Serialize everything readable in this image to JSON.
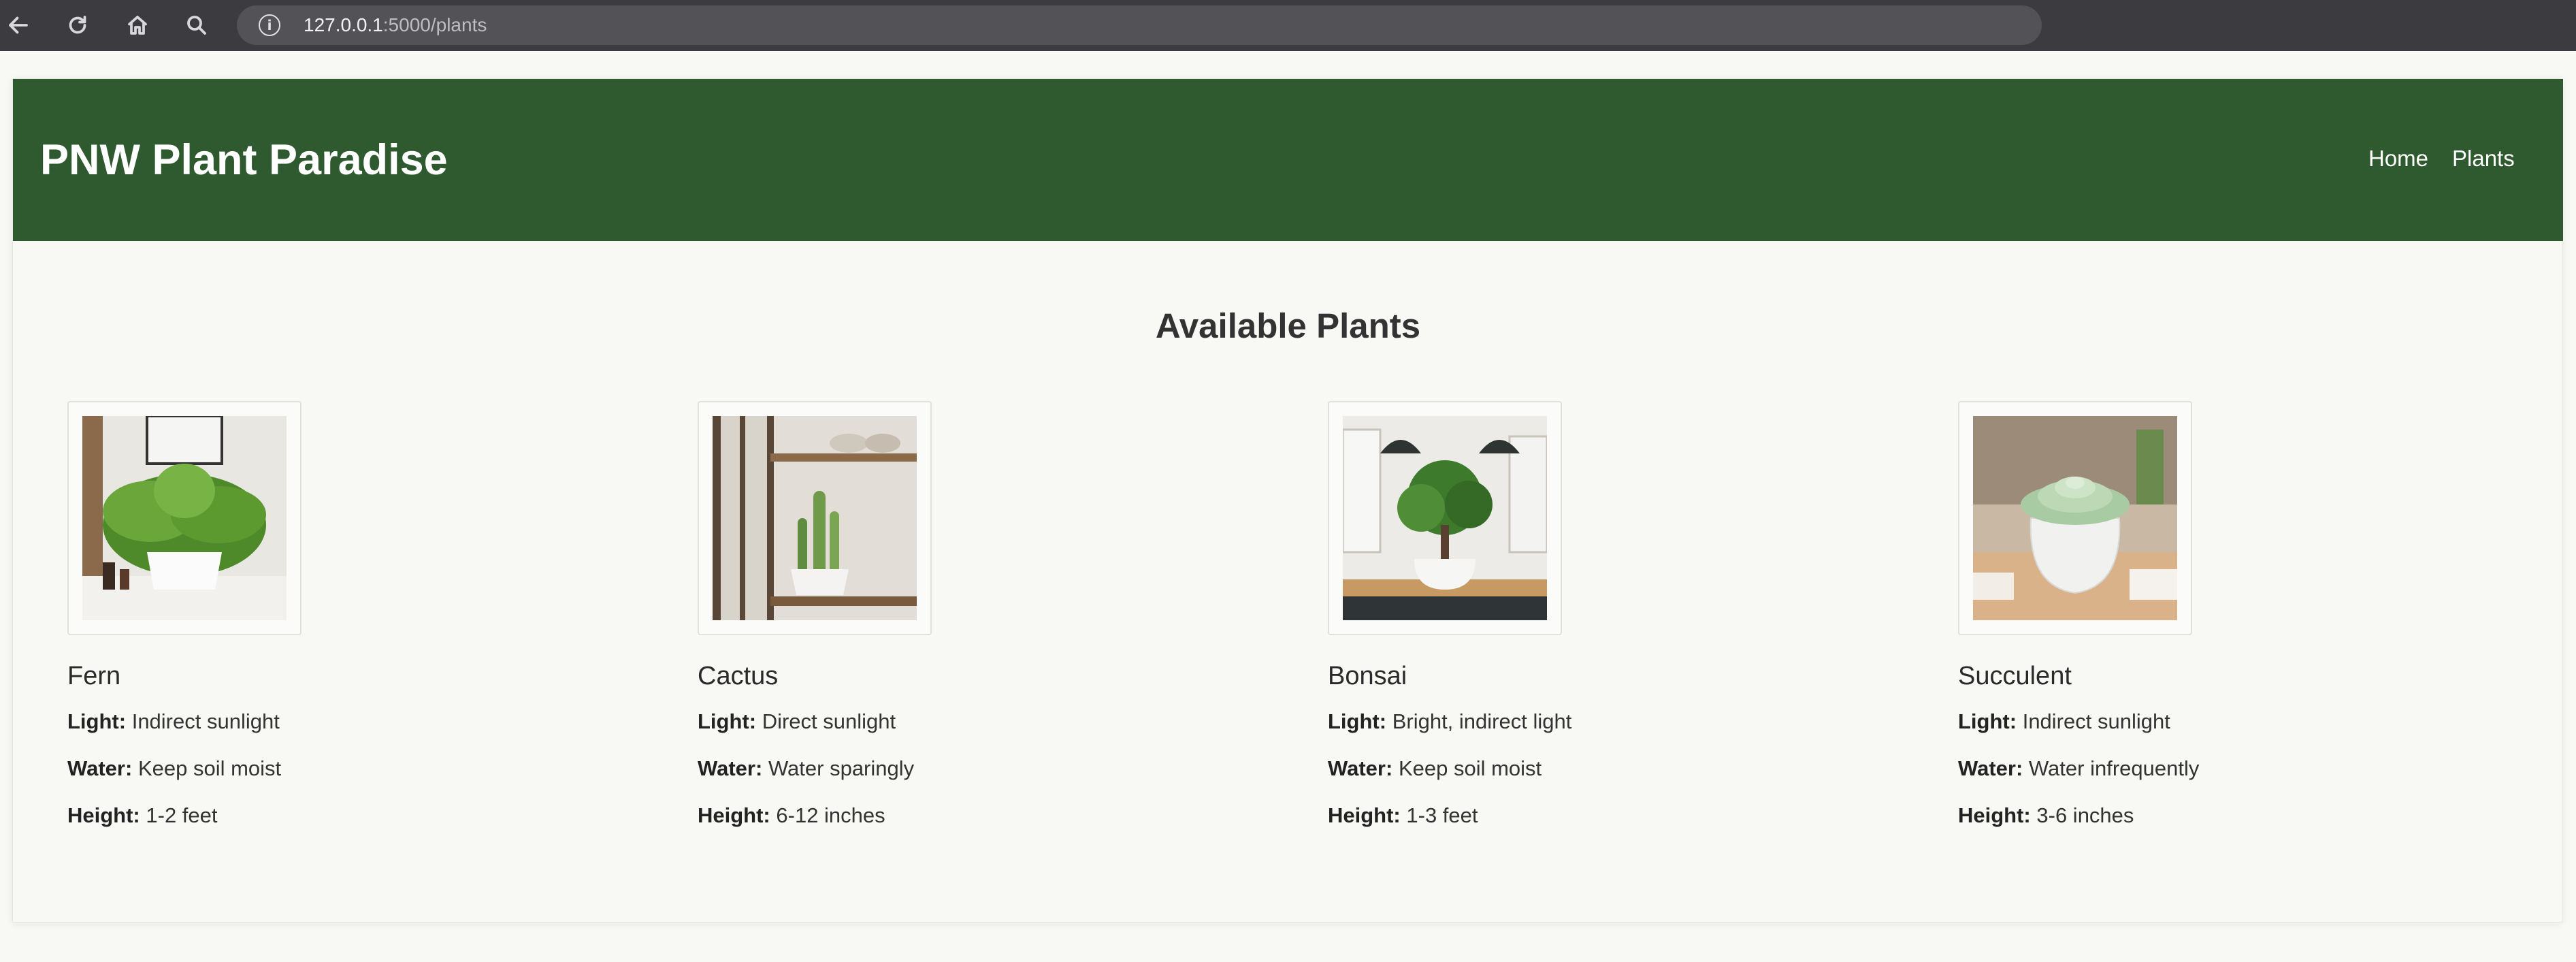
{
  "browser": {
    "url_host": "127.0.0.1",
    "url_path": ":5000/plants"
  },
  "header": {
    "brand": "PNW Plant Paradise",
    "nav": [
      "Home",
      "Plants"
    ]
  },
  "main": {
    "title": "Available Plants",
    "plants": [
      {
        "name": "Fern",
        "light_label": "Light:",
        "light": "Indirect sunlight",
        "water_label": "Water:",
        "water": "Keep soil moist",
        "height_label": "Height:",
        "height": "1-2 feet",
        "icon": "fern-photo"
      },
      {
        "name": "Cactus",
        "light_label": "Light:",
        "light": "Direct sunlight",
        "water_label": "Water:",
        "water": "Water sparingly",
        "height_label": "Height:",
        "height": "6-12 inches",
        "icon": "cactus-photo"
      },
      {
        "name": "Bonsai",
        "light_label": "Light:",
        "light": "Bright, indirect light",
        "water_label": "Water:",
        "water": "Keep soil moist",
        "height_label": "Height:",
        "height": "1-3 feet",
        "icon": "bonsai-photo"
      },
      {
        "name": "Succulent",
        "light_label": "Light:",
        "light": "Indirect sunlight",
        "water_label": "Water:",
        "water": "Water infrequently",
        "height_label": "Height:",
        "height": "3-6 inches",
        "icon": "succulent-photo"
      }
    ]
  },
  "colors": {
    "header_bg": "#2f5a2f",
    "page_bg": "#f8f8f5",
    "chrome_bg": "#3c3c40"
  }
}
